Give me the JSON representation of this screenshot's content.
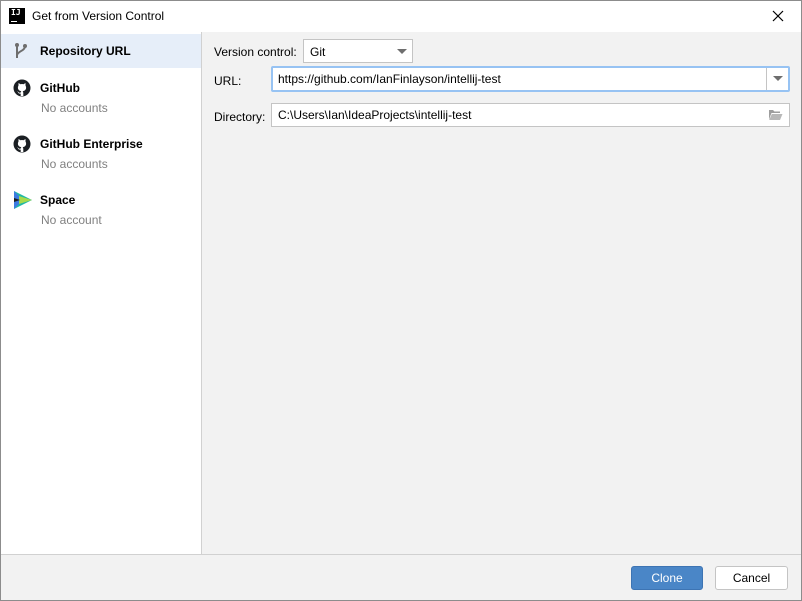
{
  "window": {
    "title": "Get from Version Control",
    "app_icon_text": "IJ"
  },
  "sidebar": {
    "items": [
      {
        "title": "Repository URL",
        "subtitle": "",
        "icon": "branch-icon",
        "selected": true
      },
      {
        "title": "GitHub",
        "subtitle": "No accounts",
        "icon": "github-icon"
      },
      {
        "title": "GitHub Enterprise",
        "subtitle": "No accounts",
        "icon": "github-icon"
      },
      {
        "title": "Space",
        "subtitle": "No account",
        "icon": "space-icon"
      }
    ]
  },
  "form": {
    "vcs_label": "Version control:",
    "vcs_value": "Git",
    "url_label": "URL:",
    "url_value": "https://github.com/IanFinlayson/intellij-test",
    "directory_label": "Directory:",
    "directory_value": "C:\\Users\\Ian\\IdeaProjects\\intellij-test"
  },
  "footer": {
    "clone_label": "Clone",
    "cancel_label": "Cancel"
  },
  "colors": {
    "accent": "#4a86c7",
    "selection": "#e6eef9",
    "focus_border": "#97c3f3",
    "muted_text": "#808080"
  }
}
